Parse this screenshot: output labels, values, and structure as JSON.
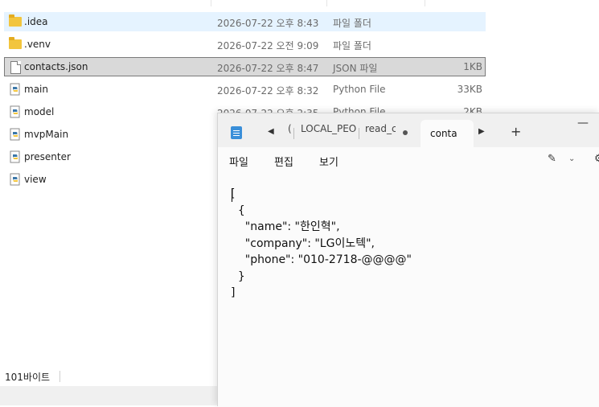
{
  "explorer": {
    "files": [
      {
        "name": ".idea",
        "date": "2026-07-22 오후 8:43",
        "type": "파일 폴더",
        "size": "",
        "icon": "folder-icon",
        "state": "hover"
      },
      {
        "name": ".venv",
        "date": "2026-07-22 오전 9:09",
        "type": "파일 폴더",
        "size": "",
        "icon": "folder-icon",
        "state": ""
      },
      {
        "name": "contacts.json",
        "date": "2026-07-22 오후 8:47",
        "type": "JSON 파일",
        "size": "1KB",
        "icon": "document-icon",
        "state": "selected"
      },
      {
        "name": "main",
        "date": "2026-07-22 오후 8:32",
        "type": "Python File",
        "size": "33KB",
        "icon": "python-file-icon",
        "state": ""
      },
      {
        "name": "model",
        "date": "2026-07-22 오후 2:35",
        "type": "Python File",
        "size": "2KB",
        "icon": "python-file-icon",
        "state": ""
      },
      {
        "name": "mvpMain",
        "date": "",
        "type": "",
        "size": "",
        "icon": "python-file-icon",
        "state": ""
      },
      {
        "name": "presenter",
        "date": "",
        "type": "",
        "size": "",
        "icon": "python-file-icon",
        "state": ""
      },
      {
        "name": "view",
        "date": "",
        "type": "",
        "size": "",
        "icon": "python-file-icon",
        "state": ""
      }
    ],
    "status": "101바이트"
  },
  "notepad": {
    "tabs": [
      "(",
      "LOCAL_PEOF",
      "read_c",
      "conta"
    ],
    "active_tab": "conta",
    "menu": [
      "파일",
      "편집",
      "보기"
    ],
    "content": "[\n  {\n    \"name\": \"한인혁\",\n    \"company\": \"LG이노텍\",\n    \"phone\": \"010-2718-@@@@\"\n  }\n]",
    "icons": {
      "minimize": "minimize-icon",
      "add": "plus-icon",
      "edit": "edit-icon"
    }
  },
  "colors": {
    "selection": "#d9d9d9",
    "hover": "#e5f3ff",
    "accent": "#3a8fd9"
  }
}
